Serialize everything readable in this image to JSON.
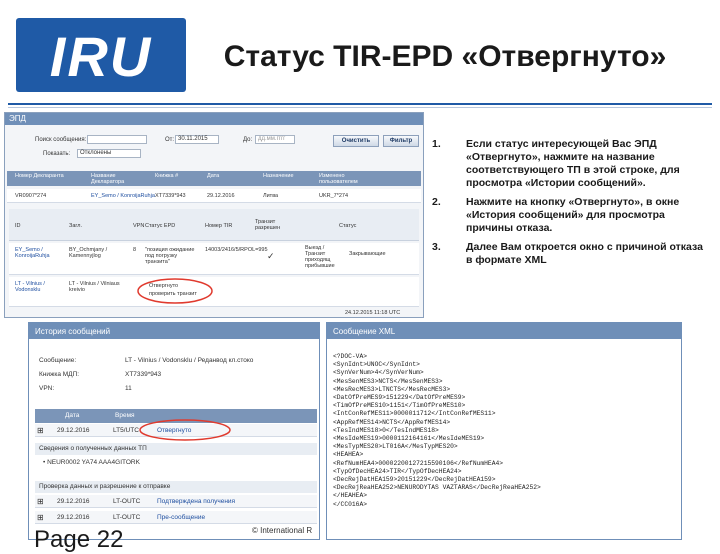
{
  "logo": {
    "text": "IRU"
  },
  "slide_title": "Статус TIR-EPD «Отвергнуто»",
  "app": {
    "title": "ЭПД",
    "search_label": "Поиск сообщения:",
    "status_label": "Показать:",
    "status_value": "Отклонены",
    "from_label": "От:",
    "from_value": "30.11.2015",
    "to_label": "До:",
    "to_value": "дд.мм.гггг",
    "clear_button": "Очистить",
    "filter_button": "Фильтр",
    "columns": [
      "Номер Декларанта",
      "Название Декларатора",
      "Книжка #",
      "Дата",
      "Назначение",
      "Изменено пользователем"
    ],
    "row": [
      "VR0907*274",
      "EY_Semo / KonroijaRuhja",
      "XT7339*943",
      "29.12.2016",
      "Литва",
      "UKR_7*274"
    ],
    "sub_columns": [
      "ID",
      "Загл.",
      "VPN",
      "Статус EPD",
      "Номер TIR",
      "Транзит разрешен",
      "Статус"
    ],
    "detail_row_1": {
      "col1": "EY_Semo / KonroijaRuhja",
      "col2": "BY_Ochmjany / Kamennyjlog",
      "vpn": "8",
      "status": "\"позиция ожидание под погрузку транзита\"",
      "tir": "14003/2416/5/RPOL=995",
      "transit": "✓",
      "decision": "Выезд / Транзит приходящ прибывшие",
      "state": "Закрывающие"
    },
    "detail_row_2": {
      "col1": "LT - Vilnius / Vodonsklu",
      "col2": "LT - Vilnius / Vilniaus kreivio",
      "status_a": "Отвергнуто",
      "status_b": "проверить транзит"
    },
    "footer_timestamp": "24.12.2015 11:18 UTC"
  },
  "instructions": [
    {
      "num": "1.",
      "text": "Если статус интересующей Вас ЭПД «Отвергнуто», нажмите на название соответствующего ТП в этой строке, для просмотра «Истории сообщений»."
    },
    {
      "num": "2.",
      "text": "Нажмите на кнопку «Отвергнуто», в окне «История сообщений» для просмотра причины отказа."
    },
    {
      "num": "3.",
      "text": "Далее Вам откроется окно с причиной отказа в формате XML"
    }
  ],
  "history": {
    "title": "История сообщений",
    "fields": [
      {
        "label": "Сообщение:",
        "value": "LT - Vilnius / Vodonsklu / Реданвод кл.стоко"
      },
      {
        "label": "Книжка МДП:",
        "value": "XT7339*943"
      },
      {
        "label": "VPN:",
        "value": "11"
      }
    ],
    "columns": [
      "Дата",
      "Время",
      "",
      ""
    ],
    "rows": [
      {
        "date": "29.12.2016",
        "time": "LT5/UTC",
        "status": "Отвергнуто"
      },
      {
        "date": "29.12.2016",
        "time": "LT-OUTC",
        "status": "Подтверждена получения"
      },
      {
        "date": "29.12.2016",
        "time": "LT-OUTC",
        "status": "Пре-сообщение"
      }
    ],
    "section_1": "Сведения о полученных данных ТП",
    "section_1_item": "• NEUR0002 YA74 AAA4GITORK",
    "section_2": "Проверка данных и разрешение к отправке"
  },
  "xml": {
    "title": "Сообщение XML",
    "lines": [
      "<?DOC-VA>",
      "<SynIdnt>UNOC</SynIdnt>",
      "<SynVerNum>4</SynVerNum>",
      "<MesSenMES3>NCTS</MesSenMES3>",
      "<MesRecMES3>LTNCTS</MesRecMES3>",
      "<DatOfPreMES9>151229</DatOfPreMES9>",
      "<TimOfPreMES10>1151</TimOfPreMES10>",
      "<IntConRefMES11>0000011712</IntConRefMES11>",
      "<AppRefMES14>NCTS</AppRefMES14>",
      "<TesIndMES18>0</TesIndMES18>",
      "<MesIdeMES19>0000112164161</MesIdeMES19>",
      "<MesTypMES20>LT016A</MesTypMES20>",
      "<HEAHEA>",
      "<RefNumHEA4>00002200127215590106</RefNumHEA4>",
      "<TypOfDecHEA24>TIR</TypOfDecHEA24>",
      "<DecRejDatHEA159>20151229</DecRejDatHEA159>",
      "<DecRejReaHEA252>NENURODYTAS VAZTARAS</DecRejReaHEA252>",
      "</HEAHEA>",
      "</CC016A>"
    ]
  },
  "footer": {
    "page": "Page 22",
    "copyright": "© International R"
  },
  "colors": {
    "brand": "#1f5aa6",
    "highlight": "#e03a2e",
    "panel_header": "#6f8fb8"
  }
}
